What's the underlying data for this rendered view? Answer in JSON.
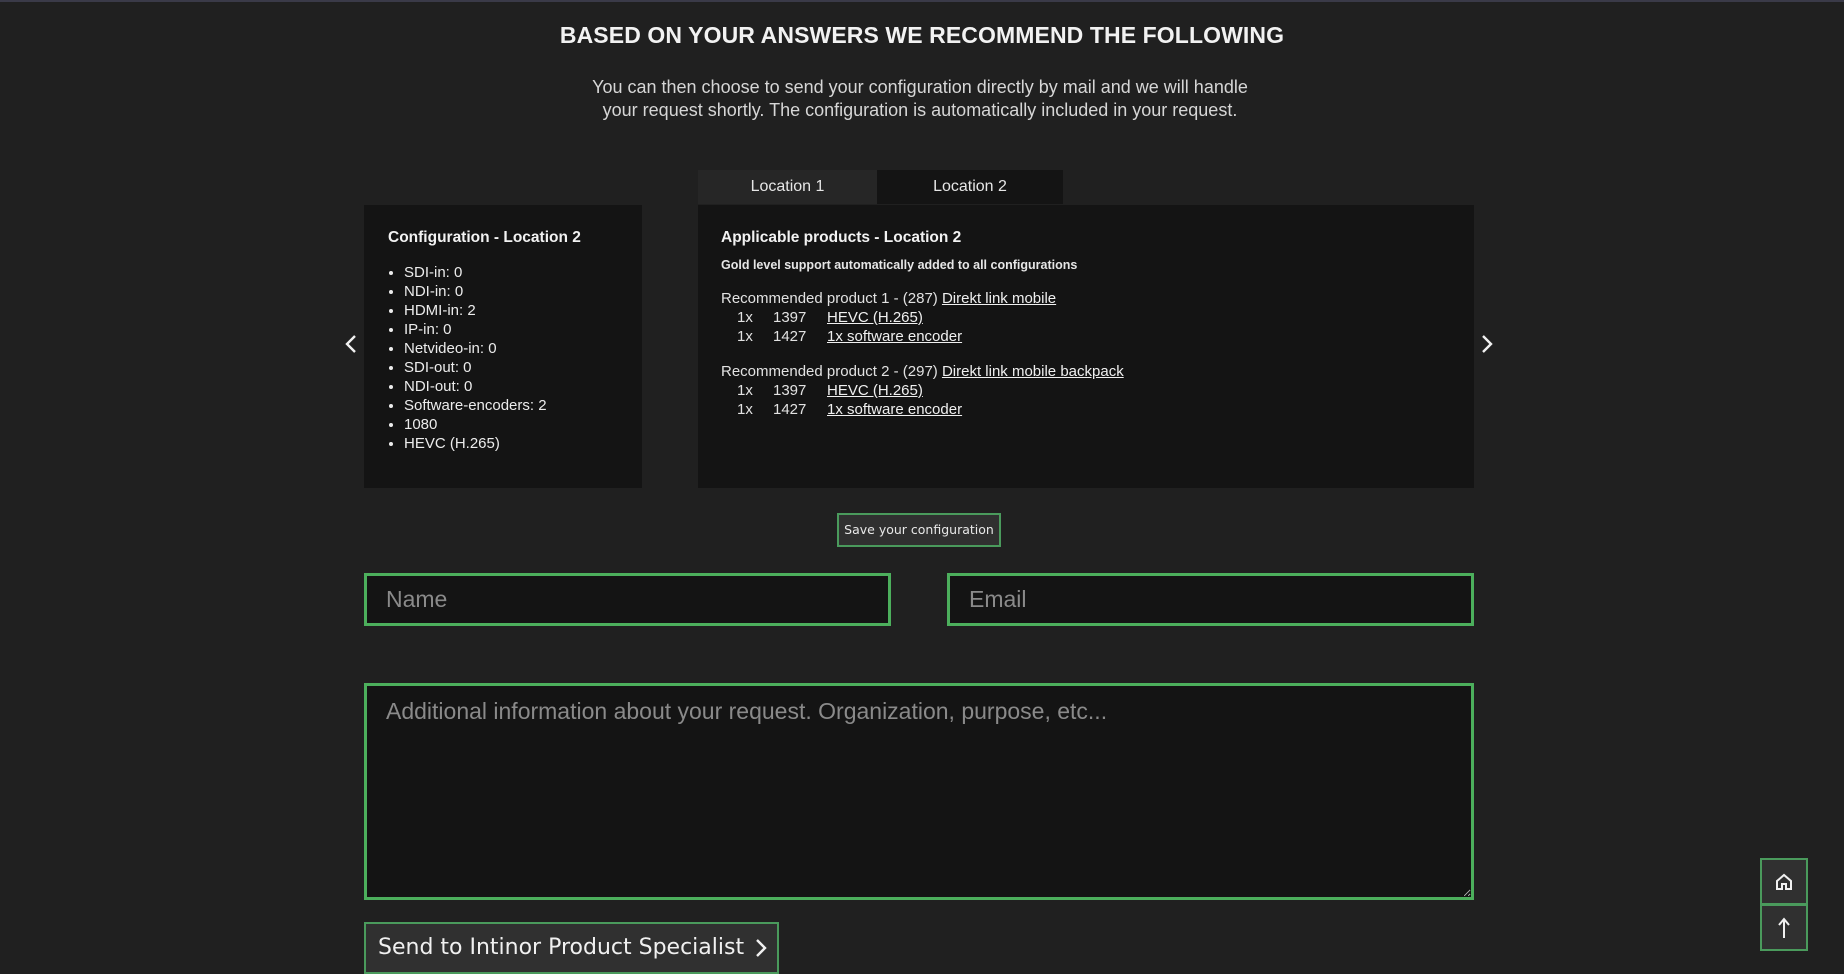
{
  "header": {
    "title": "BASED ON YOUR ANSWERS WE RECOMMEND THE FOLLOWING",
    "intro": "You can then choose to send your configuration directly by mail and we will handle your request shortly. The configuration is automatically included in your request."
  },
  "tabs": [
    {
      "label": "Location 1",
      "active": false
    },
    {
      "label": "Location 2",
      "active": true
    }
  ],
  "config": {
    "heading": "Configuration - Location 2",
    "items": [
      "SDI-in: 0",
      "NDI-in: 0",
      "HDMI-in: 2",
      "IP-in: 0",
      "Netvideo-in: 0",
      "SDI-out: 0",
      "NDI-out: 0",
      "Software-encoders: 2",
      "1080",
      "HEVC (H.265)"
    ]
  },
  "products": {
    "heading": "Applicable products - Location 2",
    "support_note": "Gold level support automatically added to all configurations",
    "recommended": [
      {
        "prefix": "Recommended product 1 - (287) ",
        "link": "Direkt link mobile",
        "items": [
          {
            "qty": "1x",
            "code": "1397",
            "name": "HEVC (H.265)"
          },
          {
            "qty": "1x",
            "code": "1427",
            "name": "1x software encoder"
          }
        ]
      },
      {
        "prefix": "Recommended product 2 - (297) ",
        "link": "Direkt link mobile backpack",
        "items": [
          {
            "qty": "1x",
            "code": "1397",
            "name": "HEVC (H.265)"
          },
          {
            "qty": "1x",
            "code": "1427",
            "name": "1x software encoder"
          }
        ]
      }
    ]
  },
  "nav": {
    "prev_icon": "chevron-left-icon",
    "next_icon": "chevron-right-icon"
  },
  "actions": {
    "save_label": "Save your configuration",
    "send_label": "Send to Intinor Product Specialist"
  },
  "form": {
    "name_placeholder": "Name",
    "name_value": "",
    "email_placeholder": "Email",
    "email_value": "",
    "info_placeholder": "Additional information about your request. Organization, purpose, etc...",
    "info_value": ""
  },
  "floating": {
    "home_icon": "home-icon",
    "top_icon": "arrow-up-icon"
  },
  "colors": {
    "accent": "#4caf5c",
    "background": "#202020",
    "panel": "#141414"
  }
}
